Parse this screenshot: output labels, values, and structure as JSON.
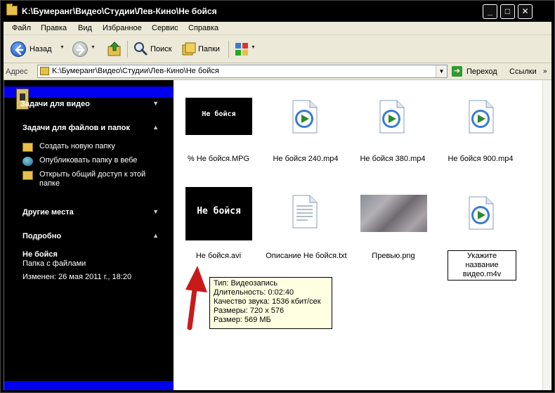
{
  "window": {
    "title": "K:\\Бумеранг\\Видео\\Студии\\Лев-Кино\\Не бойся",
    "buttons": {
      "minimize": "_",
      "maximize": "□",
      "close": "✕"
    }
  },
  "menu": [
    "Файл",
    "Правка",
    "Вид",
    "Избранное",
    "Сервис",
    "Справка"
  ],
  "toolbar": {
    "back_label": "Назад",
    "search_label": "Поиск",
    "folders_label": "Папки"
  },
  "address": {
    "label": "Адрес",
    "value": "K:\\Бумеранг\\Видео\\Студии\\Лев-Кино\\Не бойся",
    "go_label": "Переход",
    "links_label": "Ссылки"
  },
  "taskpane": {
    "video_tasks": "Задачи для видео",
    "file_tasks_header": "Задачи для файлов и папок",
    "file_tasks": [
      {
        "label": "Создать новую папку",
        "icon": "new-folder-icon"
      },
      {
        "label": "Опубликовать папку в вебе",
        "icon": "publish-web-icon"
      },
      {
        "label": "Открыть общий доступ к этой",
        "label2": "папке",
        "icon": "share-folder-icon"
      }
    ],
    "other_places_header": "Другие места",
    "details_header": "Подробно",
    "details": {
      "name": "Не бойся",
      "type": "Папка с файлами",
      "modified": "Изменен: 26 мая 2011 г., 18:20"
    }
  },
  "files": [
    {
      "name": "% Не бойся.MPG",
      "thumb_text": "Не бойся",
      "kind": "mpg-thumbnail"
    },
    {
      "name": "Не бойся 240.mp4",
      "kind": "media-player-icon"
    },
    {
      "name": "Не бойся 380.mp4",
      "kind": "media-player-icon"
    },
    {
      "name": "Не бойся 900.mp4",
      "kind": "media-player-icon"
    },
    {
      "name": "Не бойся.avi",
      "thumb_text": "Не бойся",
      "kind": "avi-thumbnail"
    },
    {
      "name": "Описание Не бойся.txt",
      "kind": "text-file-icon"
    },
    {
      "name": "Превью.png",
      "kind": "image-thumbnail"
    },
    {
      "name": "Укажите название",
      "name2": "видео.m4v",
      "kind": "media-player-icon"
    }
  ],
  "tooltip": [
    "Тип: Видеозапись",
    "Длительность: 0:02:40",
    "Качество звука: 1536 кбит/сек",
    "Размеры: 720 x 576",
    "Размер: 569 МБ"
  ],
  "colors": {
    "accent_blue": "#0000ee",
    "arrow_red": "#c81a1a",
    "tooltip_bg": "#ffffe1"
  }
}
